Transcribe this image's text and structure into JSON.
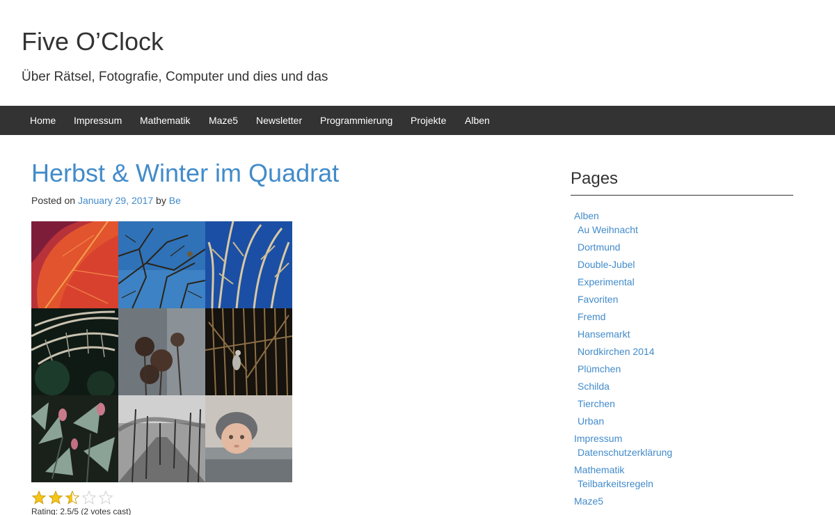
{
  "site": {
    "title": "Five O’Clock",
    "description": "Über Rätsel, Fotografie, Computer und dies und das"
  },
  "nav": {
    "items": [
      {
        "label": "Home"
      },
      {
        "label": "Impressum"
      },
      {
        "label": "Mathematik"
      },
      {
        "label": "Maze5"
      },
      {
        "label": "Newsletter"
      },
      {
        "label": "Programmierung"
      },
      {
        "label": "Projekte"
      },
      {
        "label": "Alben"
      }
    ]
  },
  "post": {
    "title": "Herbst & Winter im Quadrat",
    "posted_on_label": "Posted on",
    "date": "January 29, 2017",
    "by_label": "by",
    "author": "Be",
    "rating": {
      "value": 2.5,
      "max": 5,
      "text": "Rating: 2.5/5 (2 votes cast)"
    }
  },
  "sidebar": {
    "title": "Pages",
    "pages": [
      {
        "label": "Alben",
        "level": 0
      },
      {
        "label": "Au Weihnacht",
        "level": 1
      },
      {
        "label": "Dortmund",
        "level": 1
      },
      {
        "label": "Double-Jubel",
        "level": 1
      },
      {
        "label": "Experimental",
        "level": 1
      },
      {
        "label": "Favoriten",
        "level": 1
      },
      {
        "label": "Fremd",
        "level": 1
      },
      {
        "label": "Hansemarkt",
        "level": 1
      },
      {
        "label": "Nordkirchen 2014",
        "level": 1
      },
      {
        "label": "Plümchen",
        "level": 1
      },
      {
        "label": "Schilda",
        "level": 1
      },
      {
        "label": "Tierchen",
        "level": 1
      },
      {
        "label": "Urban",
        "level": 1
      },
      {
        "label": "Impressum",
        "level": 0
      },
      {
        "label": "Datenschutzerklärung",
        "level": 1
      },
      {
        "label": "Mathematik",
        "level": 0
      },
      {
        "label": "Teilbarkeitsregeln",
        "level": 1
      },
      {
        "label": "Maze5",
        "level": 0
      }
    ]
  },
  "colors": {
    "link": "#428bca",
    "navbar": "#333333",
    "star_filled": "#f5c518",
    "star_empty": "#dddddd"
  }
}
